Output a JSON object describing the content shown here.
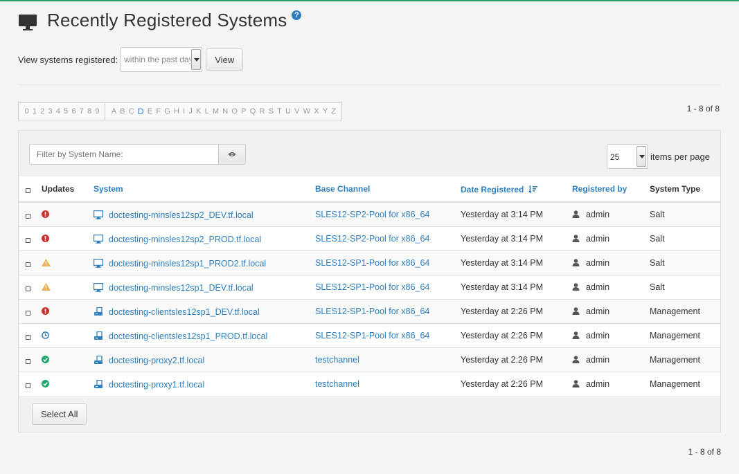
{
  "header": {
    "title": "Recently Registered Systems",
    "help": "?"
  },
  "view": {
    "label": "View systems registered:",
    "selected": "within the past day",
    "button": "View"
  },
  "alphabar": {
    "digits": [
      "0",
      "1",
      "2",
      "3",
      "4",
      "5",
      "6",
      "7",
      "8",
      "9"
    ],
    "letters": [
      "A",
      "B",
      "C",
      "D",
      "E",
      "F",
      "G",
      "H",
      "I",
      "J",
      "K",
      "L",
      "M",
      "N",
      "O",
      "P",
      "Q",
      "R",
      "S",
      "T",
      "U",
      "V",
      "W",
      "X",
      "Y",
      "Z"
    ],
    "active": "D"
  },
  "pagination": {
    "text": "1 - 8 of 8"
  },
  "filter": {
    "placeholder": "Filter by System Name:"
  },
  "per_page": {
    "value": "25",
    "label": "items per page"
  },
  "table": {
    "columns": {
      "updates": "Updates",
      "system": "System",
      "base_channel": "Base Channel",
      "date_registered": "Date Registered",
      "registered_by": "Registered by",
      "system_type": "System Type"
    },
    "rows": [
      {
        "status": "critical",
        "kind": "salt",
        "system": "doctesting-minsles12sp2_DEV.tf.local",
        "base_channel": "SLES12-SP2-Pool for x86_64",
        "date": "Yesterday at 3:14 PM",
        "user": "admin",
        "type": "Salt"
      },
      {
        "status": "critical",
        "kind": "salt",
        "system": "doctesting-minsles12sp2_PROD.tf.local",
        "base_channel": "SLES12-SP2-Pool for x86_64",
        "date": "Yesterday at 3:14 PM",
        "user": "admin",
        "type": "Salt"
      },
      {
        "status": "warning",
        "kind": "salt",
        "system": "doctesting-minsles12sp1_PROD2.tf.local",
        "base_channel": "SLES12-SP1-Pool for x86_64",
        "date": "Yesterday at 3:14 PM",
        "user": "admin",
        "type": "Salt"
      },
      {
        "status": "warning",
        "kind": "salt",
        "system": "doctesting-minsles12sp1_DEV.tf.local",
        "base_channel": "SLES12-SP1-Pool for x86_64",
        "date": "Yesterday at 3:14 PM",
        "user": "admin",
        "type": "Salt"
      },
      {
        "status": "critical",
        "kind": "management",
        "system": "doctesting-clientsles12sp1_DEV.tf.local",
        "base_channel": "SLES12-SP1-Pool for x86_64",
        "date": "Yesterday at 2:26 PM",
        "user": "admin",
        "type": "Management"
      },
      {
        "status": "pending",
        "kind": "management",
        "system": "doctesting-clientsles12sp1_PROD.tf.local",
        "base_channel": "SLES12-SP1-Pool for x86_64",
        "date": "Yesterday at 2:26 PM",
        "user": "admin",
        "type": "Management"
      },
      {
        "status": "ok",
        "kind": "management",
        "system": "doctesting-proxy2.tf.local",
        "base_channel": "testchannel",
        "date": "Yesterday at 2:26 PM",
        "user": "admin",
        "type": "Management"
      },
      {
        "status": "ok",
        "kind": "management",
        "system": "doctesting-proxy1.tf.local",
        "base_channel": "testchannel",
        "date": "Yesterday at 2:26 PM",
        "user": "admin",
        "type": "Management"
      }
    ]
  },
  "select_all": "Select All",
  "colors": {
    "accent": "#2e7fbf",
    "critical": "#c9302c",
    "warning": "#f0ad4e",
    "ok": "#1fa66a",
    "pending": "#2e7fbf",
    "top_bar": "#1f9e6a"
  },
  "icons": {
    "critical": "exclamation-circle-icon",
    "warning": "warning-triangle-icon",
    "pending": "clock-icon",
    "ok": "check-circle-icon",
    "salt": "monitor-icon",
    "management": "server-icon",
    "user": "user-icon"
  }
}
